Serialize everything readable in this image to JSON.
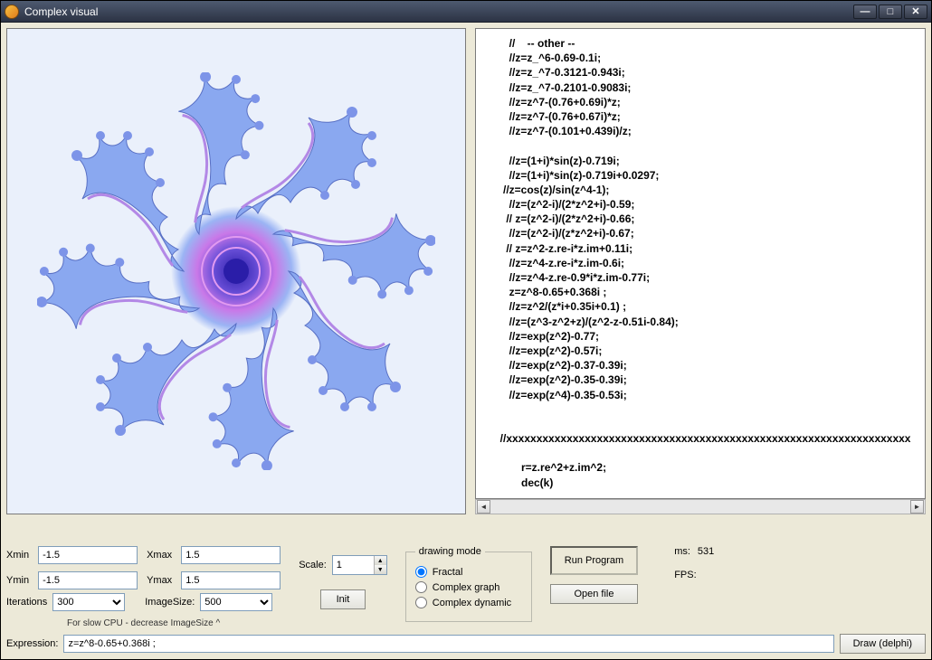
{
  "window": {
    "title": "Complex visual"
  },
  "code_text": "        //    -- other --\n        //z=z_^6-0.69-0.1i;\n        //z=z_^7-0.3121-0.943i;\n        //z=z_^7-0.2101-0.9083i;\n        //z=z^7-(0.76+0.69i)*z;\n        //z=z^7-(0.76+0.67i)*z;\n        //z=z^7-(0.101+0.439i)/z;\n\n        //z=(1+i)*sin(z)-0.719i;\n        //z=(1+i)*sin(z)-0.719i+0.0297;\n      //z=cos(z)/sin(z^4-1);\n        //z=(z^2-i)/(2*z^2+i)-0.59;\n       // z=(z^2-i)/(2*z^2+i)-0.66;\n        //z=(z^2-i)/(z*z^2+i)-0.67;\n       // z=z^2-z.re-i*z.im+0.11i;\n        //z=z^4-z.re-i*z.im-0.6i;\n        //z=z^4-z.re-0.9*i*z.im-0.77i;\n        z=z^8-0.65+0.368i ;\n        //z=z^2/(z*i+0.35i+0.1) ;\n        //z=(z^3-z^2+z)/(z^2-z-0.51i-0.84);\n        //z=exp(z^2)-0.77;\n        //z=exp(z^2)-0.57i;\n        //z=exp(z^2)-0.37-0.39i;\n        //z=exp(z^2)-0.35-0.39i;\n        //z=exp(z^4)-0.35-0.53i;\n\n\n     //xxxxxxxxxxxxxxxxxxxxxxxxxxxxxxxxxxxxxxxxxxxxxxxxxxxxxxxxxxxxxxxxxxx\n\n            r=z.re^2+z.im^2;\n            dec(k)\n\n             );",
  "coords": {
    "xmin_label": "Xmin",
    "xmin": "-1.5",
    "xmax_label": "Xmax",
    "xmax": "1.5",
    "ymin_label": "Ymin",
    "ymin": "-1.5",
    "ymax_label": "Ymax",
    "ymax": "1.5"
  },
  "iterations_label": "Iterations",
  "iterations_value": "300",
  "imagesize_label": "ImageSize:",
  "imagesize_value": "500",
  "hint_text": "For slow CPU - decrease ImageSize ^",
  "scale_label": "Scale:",
  "scale_value": "1",
  "init_label": "Init",
  "drawing_mode": {
    "legend": "drawing mode",
    "options": [
      "Fractal",
      "Complex graph",
      "Complex dynamic"
    ],
    "selected": 0
  },
  "run_label": "Run Program",
  "open_label": "Open file",
  "ms_label": "ms:",
  "ms_value": "531",
  "fps_label": "FPS:",
  "fps_value": "",
  "expression_label": "Expression:",
  "expression_value": "z=z^8-0.65+0.368i ;",
  "draw_label": "Draw (delphi)"
}
